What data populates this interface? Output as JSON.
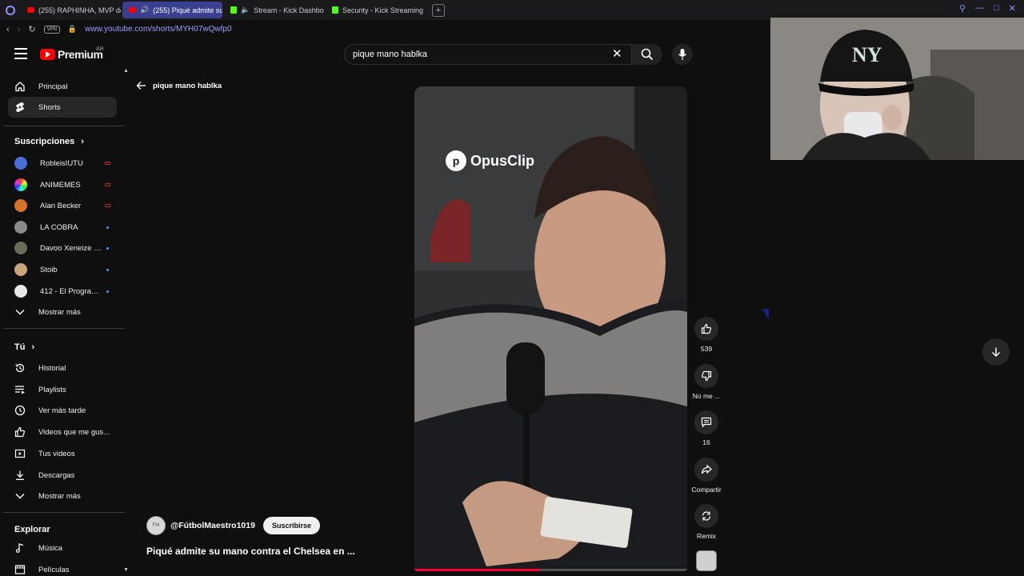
{
  "browser": {
    "tabs": [
      {
        "label": "(255) RAPHINHA, MVP de",
        "favicon": "youtube",
        "active": false
      },
      {
        "label": "(255) Piqué admite su",
        "favicon": "youtube",
        "active": true,
        "audio": true
      },
      {
        "label": "Stream - Kick Dashbo",
        "favicon": "kick",
        "active": false,
        "audio": true
      },
      {
        "label": "Security - Kick Streaming",
        "favicon": "kick",
        "active": false
      }
    ],
    "url": "www.youtube.com/shorts/MYH07wQwfp0",
    "vpn_label": "VPN"
  },
  "header": {
    "logo_text": "Premium",
    "country": "AR",
    "search_value": "pique mano hablka"
  },
  "sidebar": {
    "main_items": [
      {
        "label": "Principal",
        "icon": "home-icon"
      },
      {
        "label": "Shorts",
        "icon": "shorts-icon",
        "active": true
      }
    ],
    "subscriptions_heading": "Suscripciones",
    "subscriptions": [
      {
        "label": "RobleisIUTU",
        "indicator": "live",
        "color": "#4a6fd8"
      },
      {
        "label": "ANIMEMES",
        "indicator": "live",
        "color": "#5fc24a"
      },
      {
        "label": "Alan Becker",
        "indicator": "live",
        "color": "#d8722a"
      },
      {
        "label": "LA COBRA",
        "indicator": "new",
        "color": "#8a8a8a"
      },
      {
        "label": "Davoo Xeneize P...",
        "indicator": "new",
        "color": "#6d6a55"
      },
      {
        "label": "Stoib",
        "indicator": "new",
        "color": "#c9a47a"
      },
      {
        "label": "412 - El Program...",
        "indicator": "new",
        "color": "#e8e8e8"
      }
    ],
    "subscriptions_more": "Mostrar más",
    "you_heading": "Tú",
    "you_items": [
      {
        "label": "Historial",
        "icon": "history-icon"
      },
      {
        "label": "Playlists",
        "icon": "playlist-icon"
      },
      {
        "label": "Ver más tarde",
        "icon": "clock-icon"
      },
      {
        "label": "Videos que me gus...",
        "icon": "thumbs-up-icon"
      },
      {
        "label": "Tus videos",
        "icon": "video-icon"
      },
      {
        "label": "Descargas",
        "icon": "download-icon"
      },
      {
        "label": "Mostrar más",
        "icon": "chevron-down-icon"
      }
    ],
    "explore_heading": "Explorar",
    "explore_items": [
      {
        "label": "Música",
        "icon": "music-icon"
      },
      {
        "label": "Películas",
        "icon": "film-icon"
      }
    ]
  },
  "main": {
    "back_label": "pique mano hablka",
    "video": {
      "watermark": "OpusClip",
      "progress": 0.46
    },
    "channel_handle": "@FútbolMaestro1019",
    "subscribe_label": "Suscribirse",
    "title": "Piqué admite su mano contra el Chelsea en ...",
    "actions": {
      "likes": "539",
      "dislike_label": "No me ...",
      "comments": "16",
      "share_label": "Compartir",
      "remix_label": "Remix"
    }
  },
  "colors": {
    "background": "#0f0f0f",
    "accent": "#ff0000",
    "active_tab": "#3a3f8f"
  }
}
